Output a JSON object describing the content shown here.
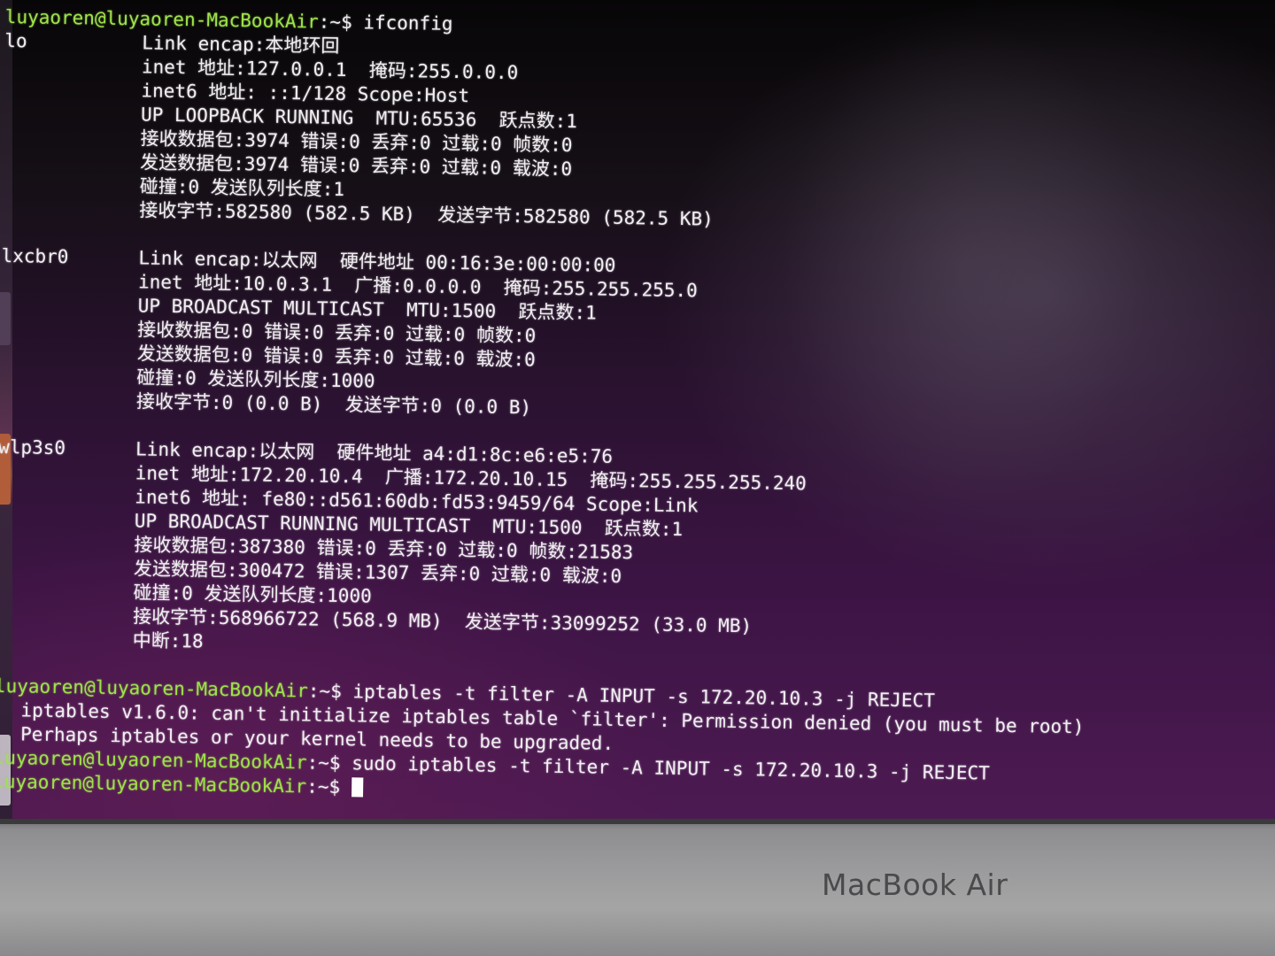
{
  "terminal": {
    "lines": [
      {
        "prompt": "luyaoren@luyaoren-MacBookAir",
        "path": ":~$ ",
        "command": "ifconfig"
      },
      {
        "iface": "lo",
        "text": "Link encap:本地环回"
      },
      {
        "text": "inet 地址:127.0.0.1  掩码:255.0.0.0"
      },
      {
        "text": "inet6 地址: ::1/128 Scope:Host"
      },
      {
        "text": "UP LOOPBACK RUNNING  MTU:65536  跃点数:1"
      },
      {
        "text": "接收数据包:3974 错误:0 丢弃:0 过载:0 帧数:0"
      },
      {
        "text": "发送数据包:3974 错误:0 丢弃:0 过载:0 载波:0"
      },
      {
        "text": "碰撞:0 发送队列长度:1"
      },
      {
        "text": "接收字节:582580 (582.5 KB)  发送字节:582580 (582.5 KB)"
      },
      {
        "text": ""
      },
      {
        "iface": "lxcbr0",
        "text": "Link encap:以太网  硬件地址 00:16:3e:00:00:00"
      },
      {
        "text": "inet 地址:10.0.3.1  广播:0.0.0.0  掩码:255.255.255.0"
      },
      {
        "text": "UP BROADCAST MULTICAST  MTU:1500  跃点数:1"
      },
      {
        "text": "接收数据包:0 错误:0 丢弃:0 过载:0 帧数:0"
      },
      {
        "text": "发送数据包:0 错误:0 丢弃:0 过载:0 载波:0"
      },
      {
        "text": "碰撞:0 发送队列长度:1000"
      },
      {
        "text": "接收字节:0 (0.0 B)  发送字节:0 (0.0 B)"
      },
      {
        "text": ""
      },
      {
        "iface": "wlp3s0",
        "text": "Link encap:以太网  硬件地址 a4:d1:8c:e6:e5:76"
      },
      {
        "text": "inet 地址:172.20.10.4  广播:172.20.10.15  掩码:255.255.255.240"
      },
      {
        "text": "inet6 地址: fe80::d561:60db:fd53:9459/64 Scope:Link"
      },
      {
        "text": "UP BROADCAST RUNNING MULTICAST  MTU:1500  跃点数:1"
      },
      {
        "text": "接收数据包:387380 错误:0 丢弃:0 过载:0 帧数:21583"
      },
      {
        "text": "发送数据包:300472 错误:1307 丢弃:0 过载:0 载波:0"
      },
      {
        "text": "碰撞:0 发送队列长度:1000"
      },
      {
        "text": "接收字节:568966722 (568.9 MB)  发送字节:33099252 (33.0 MB)"
      },
      {
        "text": "中断:18"
      },
      {
        "text": ""
      },
      {
        "prompt": "luyaoren@luyaoren-MacBookAir",
        "path": ":~$ ",
        "command": "iptables -t filter -A INPUT -s 172.20.10.3 -j REJECT"
      },
      {
        "text": "iptables v1.6.0: can't initialize iptables table `filter': Permission denied (you must be root)"
      },
      {
        "text": "Perhaps iptables or your kernel needs to be upgraded."
      },
      {
        "prompt": "luyaoren@luyaoren-MacBookAir",
        "path": ":~$ ",
        "command": "sudo iptables -t filter -A INPUT -s 172.20.10.3 -j REJECT"
      },
      {
        "prompt": "luyaoren@luyaoren-MacBookAir",
        "path": ":~$ ",
        "command": "",
        "cursor": true
      }
    ]
  },
  "laptop": {
    "brand": "MacBook Air"
  },
  "colors": {
    "prompt": "#9ee24a",
    "text": "#f1eef2",
    "background": "#3c1444"
  }
}
